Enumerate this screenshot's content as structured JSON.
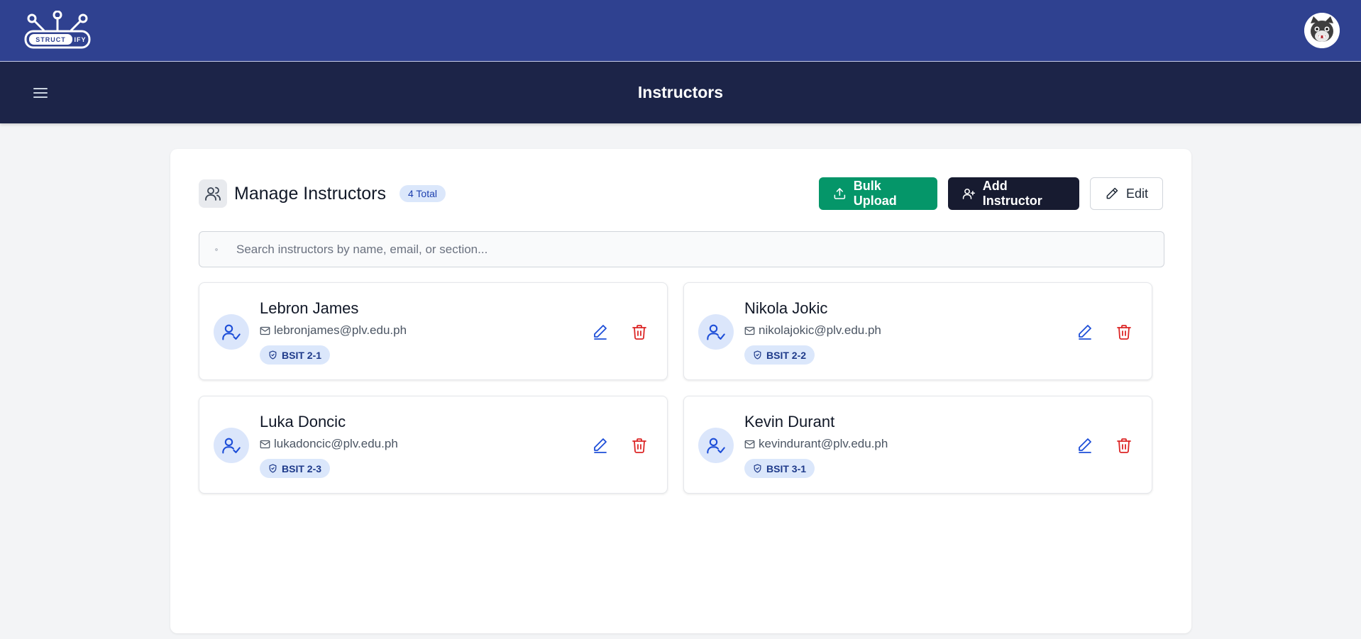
{
  "header": {
    "logo_text": "STRUCTIFY",
    "page_title": "Instructors"
  },
  "panel": {
    "title": "Manage Instructors",
    "count_badge": "4 Total",
    "buttons": {
      "bulk_upload": "Bulk Upload",
      "add_instructor": "Add Instructor",
      "edit": "Edit"
    },
    "search_placeholder": "Search instructors by name, email, or section..."
  },
  "instructors": [
    {
      "name": "Lebron James",
      "email": "lebronjames@plv.edu.ph",
      "section": "BSIT 2-1"
    },
    {
      "name": "Nikola Jokic",
      "email": "nikolajokic@plv.edu.ph",
      "section": "BSIT 2-2"
    },
    {
      "name": "Luka Doncic",
      "email": "lukadoncic@plv.edu.ph",
      "section": "BSIT 2-3"
    },
    {
      "name": "Kevin Durant",
      "email": "kevindurant@plv.edu.ph",
      "section": "BSIT 3-1"
    }
  ],
  "colors": {
    "topbar": "#2f4190",
    "subbar": "#1c2448",
    "accent_blue": "#1d4ed8",
    "delete_red": "#dc2626",
    "bulk_upload_green": "#059669",
    "add_dark": "#171b30"
  },
  "icons": [
    "menu-icon",
    "users-icon",
    "upload-icon",
    "user-plus-icon",
    "pencil-icon",
    "search-icon",
    "user-check-icon",
    "mail-icon",
    "shield-icon",
    "trash-icon"
  ]
}
